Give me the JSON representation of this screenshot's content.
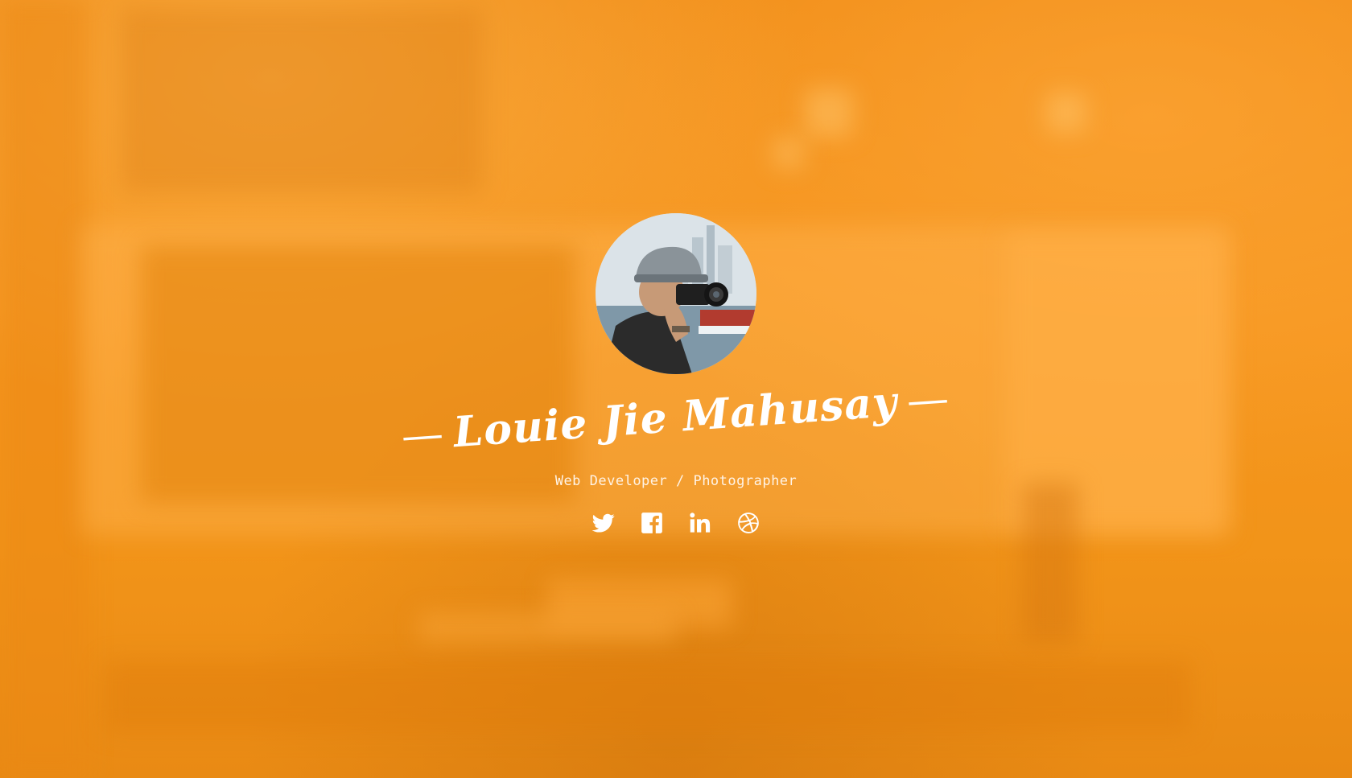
{
  "profile": {
    "name": "Louie Jie Mahusay",
    "name_prefix": "—",
    "name_suffix": "—",
    "tagline": "Web Developer / Photographer",
    "avatar_alt": "photographer holding camera"
  },
  "socials": [
    {
      "icon": "twitter-icon"
    },
    {
      "icon": "facebook-icon"
    },
    {
      "icon": "linkedin-icon"
    },
    {
      "icon": "dribbble-icon"
    }
  ],
  "colors": {
    "background": "#f6931f",
    "text": "#ffffff"
  }
}
